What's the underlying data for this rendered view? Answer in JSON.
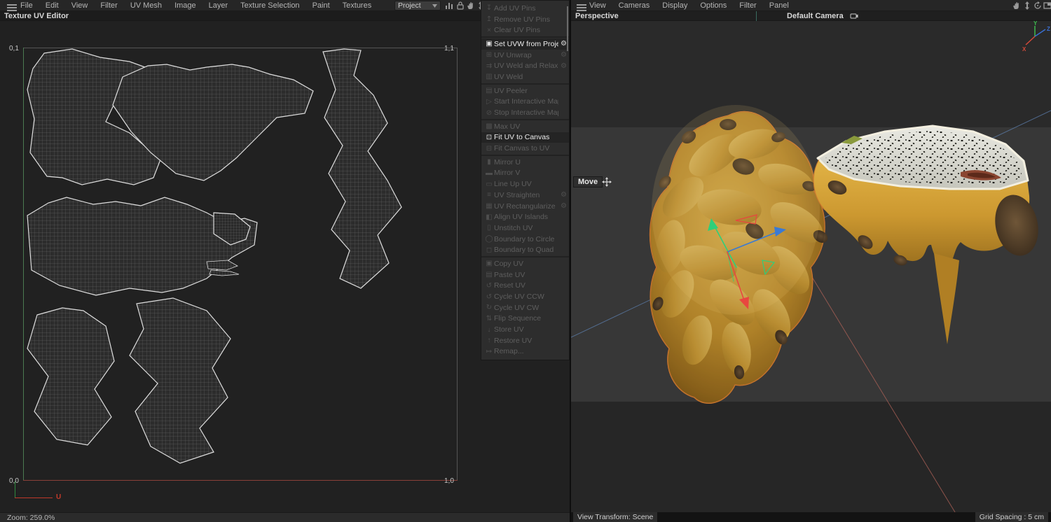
{
  "topbar": {
    "left_menu": [
      "File",
      "Edit",
      "View",
      "Filter",
      "UV Mesh",
      "Image",
      "Layer",
      "Texture Selection",
      "Paint",
      "Textures"
    ],
    "project_dropdown": "Project",
    "icons": [
      "histogram-icon",
      "lock-icon",
      "hand-icon",
      "updown-arrow-icon"
    ],
    "right_menu": [
      "View",
      "Cameras",
      "Display",
      "Options",
      "Filter",
      "Panel"
    ],
    "right_icons": [
      "hand-icon",
      "updown-arrow-icon",
      "rotate-icon",
      "maximize-frame-icon"
    ]
  },
  "left_panel": {
    "title": "Texture UV Editor",
    "uv_canvas": {
      "corner_top_left": "0,1",
      "corner_top_right": "1,1",
      "corner_bottom_left": "0,0",
      "corner_bottom_right": "1,0",
      "axis_u_label": "U",
      "axis_u_color": "#b14a3c",
      "axis_v_color": "#4c7a52"
    },
    "status_zoom": "Zoom: 259.0%"
  },
  "uv_menu": {
    "groups": [
      {
        "items": [
          {
            "label": "Add UV Pins",
            "icon": "pin-add-icon",
            "glyph": "↧",
            "enabled": false,
            "gear": false
          },
          {
            "label": "Remove UV Pins",
            "icon": "pin-remove-icon",
            "glyph": "↥",
            "enabled": false,
            "gear": false
          },
          {
            "label": "Clear UV Pins",
            "icon": "clear-icon",
            "glyph": "×",
            "enabled": false,
            "gear": false
          }
        ]
      },
      {
        "items": [
          {
            "label": "Set UVW from Projection",
            "icon": "projection-icon",
            "glyph": "▣",
            "enabled": true,
            "gear": true
          },
          {
            "label": "UV Unwrap",
            "icon": "unwrap-icon",
            "glyph": "⊞",
            "enabled": false,
            "gear": true
          },
          {
            "label": "UV Weld and Relax",
            "icon": "weld-relax-icon",
            "glyph": "⇉",
            "enabled": false,
            "gear": true
          },
          {
            "label": "UV Weld",
            "icon": "weld-icon",
            "glyph": "▥",
            "enabled": false,
            "gear": false
          }
        ]
      },
      {
        "items": [
          {
            "label": "UV Peeler",
            "icon": "peeler-icon",
            "glyph": "▤",
            "enabled": false,
            "gear": false
          },
          {
            "label": "Start Interactive Mapping",
            "icon": "play-icon",
            "glyph": "▷",
            "enabled": false,
            "gear": false
          },
          {
            "label": "Stop Interactive Mapping",
            "icon": "stop-icon",
            "glyph": "⊘",
            "enabled": false,
            "gear": false
          }
        ]
      },
      {
        "items": [
          {
            "label": "Max UV",
            "icon": "max-uv-icon",
            "glyph": "▩",
            "enabled": false,
            "gear": false
          },
          {
            "label": "Fit UV to Canvas",
            "icon": "fit-uv-icon",
            "glyph": "⊡",
            "enabled": true,
            "gear": false
          },
          {
            "label": "Fit Canvas to UV",
            "icon": "fit-canvas-icon",
            "glyph": "⊟",
            "enabled": false,
            "gear": false
          }
        ]
      },
      {
        "items": [
          {
            "label": "Mirror U",
            "icon": "mirror-u-icon",
            "glyph": "▮",
            "enabled": false,
            "gear": false
          },
          {
            "label": "Mirror V",
            "icon": "mirror-v-icon",
            "glyph": "▬",
            "enabled": false,
            "gear": false
          },
          {
            "label": "Line Up UV",
            "icon": "lineup-icon",
            "glyph": "▭",
            "enabled": false,
            "gear": false
          },
          {
            "label": "UV Straighten",
            "icon": "straighten-icon",
            "glyph": "≡",
            "enabled": false,
            "gear": true
          },
          {
            "label": "UV Rectangularize",
            "icon": "rectangularize-icon",
            "glyph": "▦",
            "enabled": false,
            "gear": true
          },
          {
            "label": "Align UV Islands",
            "icon": "align-islands-icon",
            "glyph": "◧",
            "enabled": false,
            "gear": false
          },
          {
            "label": "Unstitch UV",
            "icon": "unstitch-icon",
            "glyph": "▯",
            "enabled": false,
            "gear": false
          },
          {
            "label": "Boundary to Circle",
            "icon": "boundary-circle-icon",
            "glyph": "◯",
            "enabled": false,
            "gear": false
          },
          {
            "label": "Boundary to Quad",
            "icon": "boundary-quad-icon",
            "glyph": "◻",
            "enabled": false,
            "gear": false
          }
        ]
      },
      {
        "items": [
          {
            "label": "Copy UV",
            "icon": "copy-icon",
            "glyph": "▣",
            "enabled": false,
            "gear": false
          },
          {
            "label": "Paste UV",
            "icon": "paste-icon",
            "glyph": "▤",
            "enabled": false,
            "gear": false
          },
          {
            "label": "Reset UV",
            "icon": "reset-icon",
            "glyph": "↺",
            "enabled": false,
            "gear": false
          },
          {
            "label": "Cycle UV CCW",
            "icon": "cycle-ccw-icon",
            "glyph": "↺",
            "enabled": false,
            "gear": false
          },
          {
            "label": "Cycle UV CW",
            "icon": "cycle-cw-icon",
            "glyph": "↻",
            "enabled": false,
            "gear": false
          },
          {
            "label": "Flip Sequence",
            "icon": "flip-sequence-icon",
            "glyph": "⇅",
            "enabled": false,
            "gear": false
          },
          {
            "label": "Store UV",
            "icon": "store-icon",
            "glyph": "↓",
            "enabled": false,
            "gear": false
          },
          {
            "label": "Restore UV",
            "icon": "restore-icon",
            "glyph": "↑",
            "enabled": false,
            "gear": false
          },
          {
            "label": "Remap...",
            "icon": "remap-icon",
            "glyph": "↦",
            "enabled": false,
            "gear": false
          }
        ]
      }
    ]
  },
  "right_panel": {
    "view_label": "Perspective",
    "camera_label": "Default Camera",
    "move_tooltip": "Move",
    "status_left": "View Transform: Scene",
    "status_right": "Grid Spacing : 5 cm",
    "axis_gizmo": {
      "x": "X",
      "y": "Y",
      "z": "Z",
      "x_color": "#d24a3a",
      "y_color": "#3dba4e",
      "z_color": "#3a6fd2"
    }
  },
  "colors": {
    "selection_outline": "#cf7a2e",
    "gizmo_green": "#2ecf7a",
    "gizmo_red": "#e8473f",
    "gizmo_blue": "#3a7ad4"
  }
}
